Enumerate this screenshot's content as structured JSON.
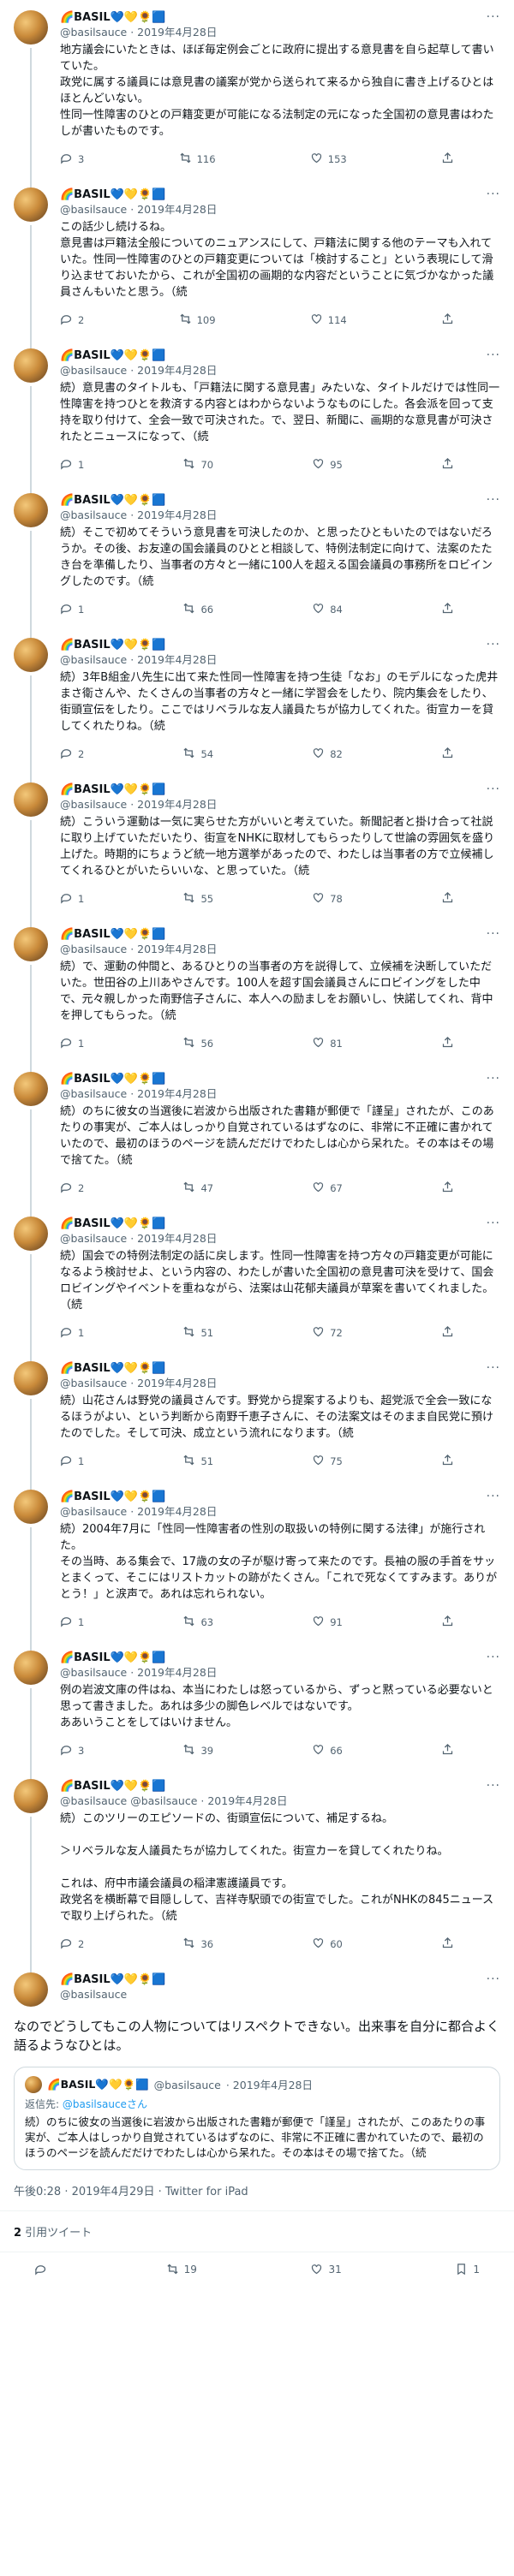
{
  "colors": {
    "link": "#1d9bf0",
    "muted": "#536471",
    "line": "#cfd9de"
  },
  "author": {
    "display_name": "🌈BASIL💙💛🌻🟦",
    "handle": "@basilsauce"
  },
  "tweets": [
    {
      "date": "· 2019年4月28日",
      "text": "地方議会にいたときは、ほぼ毎定例会ごとに政府に提出する意見書を自ら起草して書いていた。\n政党に属する議員には意見書の議案が党から送られて来るから独自に書き上げるひとはほとんどいない。\n性同一性障害のひとの戸籍変更が可能になる法制定の元になった全国初の意見書はわたしが書いたものです。",
      "replies": "3",
      "retweets": "116",
      "likes": "153"
    },
    {
      "date": "· 2019年4月28日",
      "text": "この話少し続けるね。\n意見書は戸籍法全般についてのニュアンスにして、戸籍法に関する他のテーマも入れていた。性同一性障害のひとの戸籍変更については「検討すること」という表現にして滑り込ませておいたから、これが全国初の画期的な内容だということに気づかなかった議員さんもいたと思う。（続",
      "replies": "2",
      "retweets": "109",
      "likes": "114"
    },
    {
      "date": "· 2019年4月28日",
      "text": "続）意見書のタイトルも、「戸籍法に関する意見書」みたいな、タイトルだけでは性同一性障害を持つひとを救済する内容とはわからないようなものにした。各会派を回って支持を取り付けて、全会一致で可決された。で、翌日、新聞に、画期的な意見書が可決されたとニュースになって、（続",
      "replies": "1",
      "retweets": "70",
      "likes": "95"
    },
    {
      "date": "· 2019年4月28日",
      "text": "続）そこで初めてそういう意見書を可決したのか、と思ったひともいたのではないだろうか。その後、お友達の国会議員のひとと相談して、特例法制定に向けて、法案のたたき台を準備したり、当事者の方々と一緒に100人を超える国会議員の事務所をロビイングしたのです。（続",
      "replies": "1",
      "retweets": "66",
      "likes": "84"
    },
    {
      "date": "· 2019年4月28日",
      "text": "続）3年B組金八先生に出て来た性同一性障害を持つ生徒「なお」のモデルになった虎井まさ衛さんや、たくさんの当事者の方々と一緒に学習会をしたり、院内集会をしたり、街頭宣伝をしたり。ここではリベラルな友人議員たちが協力してくれた。街宣カーを貸してくれたりね。（続",
      "replies": "2",
      "retweets": "54",
      "likes": "82"
    },
    {
      "date": "· 2019年4月28日",
      "text": "続）こういう運動は一気に実らせた方がいいと考えていた。新聞記者と掛け合って社説に取り上げていただいたり、街宣をNHKに取材してもらったりして世論の雰囲気を盛り上げた。時期的にちょうど統一地方選挙があったので、わたしは当事者の方で立候補してくれるひとがいたらいいな、と思っていた。（続",
      "replies": "1",
      "retweets": "55",
      "likes": "78"
    },
    {
      "date": "· 2019年4月28日",
      "text": "続）で、運動の仲間と、あるひとりの当事者の方を説得して、立候補を決断していただいた。世田谷の上川あやさんです。100人を超す国会議員さんにロビイングをした中で、元々親しかった南野信子さんに、本人への励ましをお願いし、快諾してくれ、背中を押してもらった。（続",
      "replies": "1",
      "retweets": "56",
      "likes": "81"
    },
    {
      "date": "· 2019年4月28日",
      "text": "続）のちに彼女の当選後に岩波から出版された書籍が郵便で「謹呈」されたが、このあたりの事実が、ご本人はしっかり自覚されているはずなのに、非常に不正確に書かれていたので、最初のほうのページを読んだだけでわたしは心から呆れた。その本はその場で捨てた。（続",
      "replies": "2",
      "retweets": "47",
      "likes": "67"
    },
    {
      "date": "· 2019年4月28日",
      "text": "続）国会での特例法制定の話に戻します。性同一性障害を持つ方々の戸籍変更が可能になるよう検討せよ、という内容の、わたしが書いた全国初の意見書可決を受けて、国会ロビイングやイベントを重ねながら、法案は山花郁夫議員が草案を書いてくれました。（続",
      "replies": "1",
      "retweets": "51",
      "likes": "72"
    },
    {
      "date": "· 2019年4月28日",
      "text": "続）山花さんは野党の議員さんです。野党から提案するよりも、超党派で全会一致になるほうがよい、という判断から南野千恵子さんに、その法案文はそのまま自民党に預けたのでした。そして可決、成立という流れになります。（続",
      "replies": "1",
      "retweets": "51",
      "likes": "75"
    },
    {
      "date": "· 2019年4月28日",
      "text": "続）2004年7月に「性同一性障害者の性別の取扱いの特例に関する法律」が施行された。\nその当時、ある集会で、17歳の女の子が駆け寄って来たのです。長袖の服の手首をサッとまくって、そこにはリストカットの跡がたくさん。「これで死なくてすみます。ありがとう！」と涙声で。あれは忘れられない。",
      "replies": "1",
      "retweets": "63",
      "likes": "91"
    },
    {
      "date": "· 2019年4月28日",
      "text": "例の岩波文庫の件はね、本当にわたしは怒っているから、ずっと黙っている必要ないと思って書きました。あれは多少の脚色レベルではないです。\nああいうことをしてはいけません。",
      "replies": "3",
      "retweets": "39",
      "likes": "66"
    },
    {
      "date": "@basilsauce · 2019年4月28日",
      "text": "続）このツリーのエピソードの、街頭宣伝について、補足するね。\n\n＞リベラルな友人議員たちが協力してくれた。街宣カーを貸してくれたりね。\n\nこれは、府中市議会議員の稲津憲護議員です。\n政党名を横断幕で目隠しして、吉祥寺駅頭での街宣でした。これがNHKの845ニュースで取り上げられた。（続",
      "replies": "2",
      "retweets": "36",
      "likes": "60"
    }
  ],
  "main": {
    "text": "なのでどうしてもこの人物についてはリスペクトできない。出来事を自分に都合よく語るようなひとは。",
    "quote": {
      "handle": "@basilsauce",
      "date": "· 2019年4月28日",
      "reply_prefix": "返信先: ",
      "reply_to": "@basilsauceさん",
      "text": "続）のちに彼女の当選後に岩波から出版された書籍が郵便で「謹呈」されたが、このあたりの事実が、ご本人はしっかり自覚されているはずなのに、非常に不正確に書かれていたので、最初のほうのページを読んだだけでわたしは心から呆れた。その本はその場で捨てた。（続"
    },
    "timestamp": "午後0:28 · 2019年4月29日 · Twitter for iPad",
    "quote_count": "2",
    "quote_label": " 引用ツイート",
    "stats": {
      "replies": "",
      "retweets": "19",
      "likes": "31",
      "bookmarks": "1"
    }
  }
}
